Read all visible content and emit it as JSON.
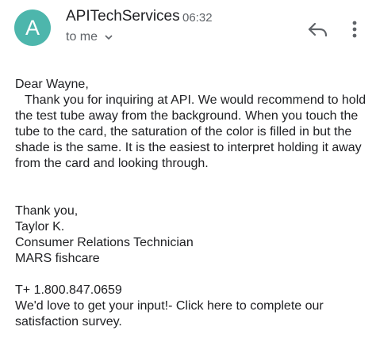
{
  "header": {
    "avatar_letter": "A",
    "avatar_color": "#4db6ac",
    "sender": "APITechServices",
    "time": "06:32",
    "recipient": "to me",
    "icons": {
      "reply": "reply-icon",
      "more": "more-vert-icon",
      "expand": "chevron-down-icon"
    }
  },
  "message": {
    "greeting": "Dear Wayne,",
    "paragraph": "Thank you for inquiring at API. We would recommend to hold the test tube away from the background.  When you touch the tube to the card, the saturation of the color is filled in but the shade is the same.  It is the easiest to interpret holding it away from the card and looking through.",
    "signature": {
      "closing": "Thank you,",
      "name": "Taylor K.",
      "title": "Consumer Relations Technician",
      "company": "MARS fishcare"
    },
    "phone": "T+ 1.800.847.0659",
    "survey": "We'd love to get your input!- Click here to complete our satisfaction survey."
  }
}
